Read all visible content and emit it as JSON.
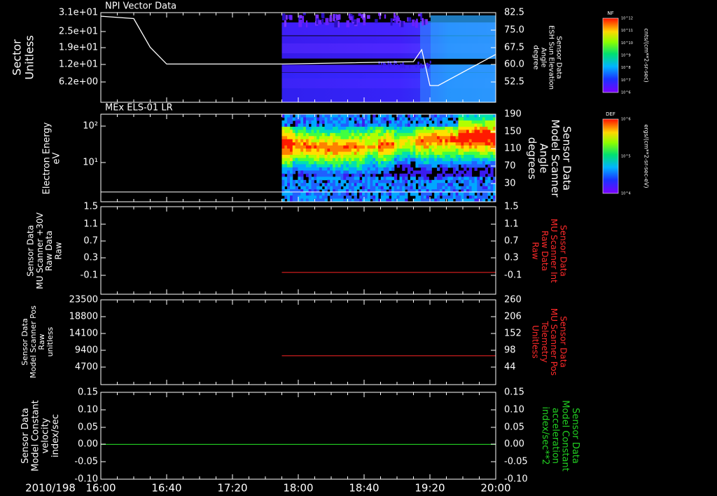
{
  "chart_data": [
    {
      "type": "heatmap",
      "title": "NPI Vector Data",
      "ylabel": "Sector Unitless",
      "yticks": [
        "3.1e+01",
        "2.5e+01",
        "1.9e+01",
        "1.2e+01",
        "6.2e+00"
      ],
      "ytick_values": [
        31,
        25,
        19,
        12,
        6.2
      ],
      "ylim": [
        0,
        33
      ],
      "y2label": [
        "Sensor Data",
        "ESH Sun Elevation",
        "Angle",
        "degree"
      ],
      "y2ticks": [
        "82.5",
        "75.0",
        "67.5",
        "60.0",
        "52.5"
      ],
      "y2lim": [
        45,
        82.5
      ],
      "data_start": "17:50",
      "colorbar": {
        "label": "NF",
        "units": "cnts/(cm**2-sr-sec)",
        "ticks": [
          "10^12",
          "10^11",
          "10^10",
          "10^9",
          "10^8",
          "10^7",
          "10^6"
        ]
      },
      "overlay_line": {
        "name": "ESH Sun Elevation",
        "x": [
          "16:00",
          "16:20",
          "16:30",
          "16:40",
          "17:50",
          "19:10",
          "19:15",
          "19:20",
          "19:25",
          "20:00"
        ],
        "y": [
          81.0,
          80.0,
          68.0,
          61.0,
          61.0,
          62.0,
          67.0,
          52.0,
          52.0,
          65.0
        ]
      }
    },
    {
      "type": "heatmap",
      "title": "MEx ELS-01 LR",
      "ylabel": [
        "Electron Energy",
        "eV"
      ],
      "yticks": [
        "10²",
        "10¹"
      ],
      "yscale": "log",
      "y2label": [
        "Sensor Data",
        "Model Scanner",
        "Angle",
        "degrees"
      ],
      "y2ticks": [
        "190",
        "150",
        "110",
        "70",
        "30"
      ],
      "y2lim": [
        10,
        190
      ],
      "data_start": "17:50",
      "colorbar": {
        "label": "DEF",
        "units": "ergs/(cm**2-sr-sec-eV)",
        "ticks": [
          "10^6",
          "10^5",
          "10^4"
        ]
      },
      "overlay_line": {
        "name": "Model Scanner Angle",
        "x": [
          "16:00",
          "20:00"
        ],
        "y": [
          12,
          12
        ]
      }
    },
    {
      "type": "line",
      "ylabel": [
        "Sensor Data",
        "MU Scanner +30V",
        "Raw Data",
        "Raw"
      ],
      "yticks": [
        "1.5",
        "1.1",
        "0.7",
        "0.3",
        "-0.1"
      ],
      "ylim": [
        -0.5,
        1.5
      ],
      "y2label": [
        "Sensor Data",
        "MU Scanner Int",
        "Raw Data",
        "Raw"
      ],
      "y2ticks": [
        "1.5",
        "1.1",
        "0.7",
        "0.3",
        "-0.1"
      ],
      "series": [
        {
          "name": "MU Scanner Int Raw Data",
          "x": [
            "17:50",
            "20:00"
          ],
          "y": [
            0.0,
            0.0
          ],
          "color": "#e02020"
        }
      ]
    },
    {
      "type": "line",
      "ylabel": [
        "Sensor Data",
        "Model Scanner Pos",
        "Raw",
        "unitless"
      ],
      "yticks": [
        "23500",
        "18800",
        "14100",
        "9400",
        "4700"
      ],
      "ylim": [
        0,
        23500
      ],
      "y2label": [
        "Sensor Data",
        "MU Scanner Pos",
        "Telemetry",
        "Unitless"
      ],
      "y2ticks": [
        "260",
        "206",
        "152",
        "98",
        "44"
      ],
      "series": [
        {
          "name": "MU Scanner Pos Telemetry",
          "x": [
            "17:50",
            "20:00"
          ],
          "y": [
            8000,
            8000
          ],
          "color": "#e02020"
        }
      ]
    },
    {
      "type": "line",
      "ylabel": [
        "Sensor Data",
        "Model Constant",
        "velocity",
        "index/sec"
      ],
      "yticks": [
        "0.15",
        "0.10",
        "0.05",
        "0.00",
        "-0.05",
        "-0.10"
      ],
      "ylim": [
        -0.1,
        0.15
      ],
      "y2label": [
        "Sensor Data",
        "Model Constant",
        "acceleration",
        "index/sec**2"
      ],
      "y2ticks": [
        "0.15",
        "0.10",
        "0.05",
        "0.00",
        "-0.05",
        "-0.10"
      ],
      "series": [
        {
          "name": "Model Constant acceleration",
          "x": [
            "16:00",
            "20:00"
          ],
          "y": [
            0.0,
            0.0
          ],
          "color": "#20c020"
        }
      ]
    }
  ],
  "x_axis": {
    "date": "2010/198",
    "ticks": [
      "16:00",
      "16:40",
      "17:20",
      "18:00",
      "18:40",
      "19:20",
      "20:00"
    ],
    "xlim": [
      "16:00",
      "20:00"
    ]
  },
  "colors": {
    "background": "#000000",
    "axis": "#ffffff",
    "red_label": "#ff2a2a",
    "green_label": "#22d022"
  }
}
